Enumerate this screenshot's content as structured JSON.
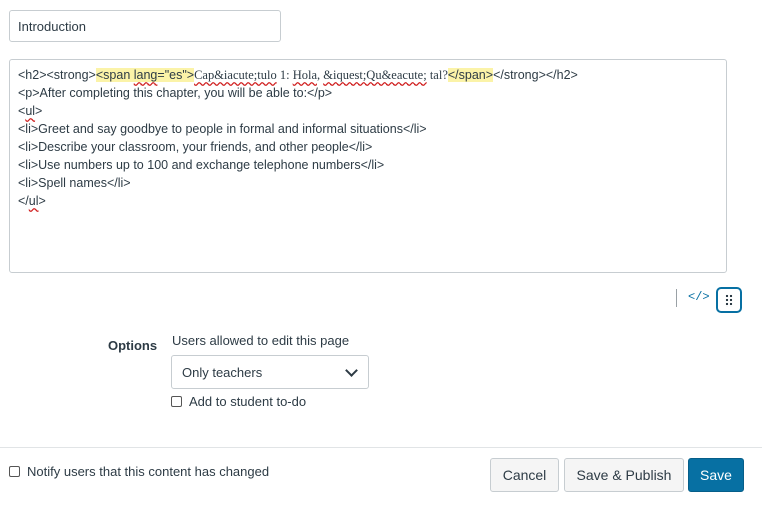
{
  "title_field": {
    "value": "Introduction"
  },
  "editor": {
    "line1": {
      "a": "<h2><strong>",
      "hl_open": {
        "a": "<span ",
        "b": "lang",
        "c": "=\"es\">"
      },
      "b1": "Cap&iacute;tulo",
      "b2": " 1: ",
      "b3": "Hola",
      "b4": ", ",
      "b5": "&iquest;Qu&eacute;",
      "b6": " tal?",
      "hl_close": "</span>",
      "c": "</strong></h2>"
    },
    "line2": "<p>After completing this chapter, you will be able to:</p>",
    "line3": {
      "a": "<",
      "b": "ul",
      "c": ">"
    },
    "line4": "<li>Greet and say goodbye to people in formal and informal situations</li>",
    "line5": "<li>Describe your classroom, your friends, and other people</li>",
    "line6": "<li>Use numbers up to 100 and exchange telephone numbers</li>",
    "line7": "<li>Spell names</li>",
    "line8": {
      "a": "</",
      "b": "ul",
      "c": ">"
    }
  },
  "toolbar": {
    "html_toggle": "</>",
    "resize_icon": "drag-handle-icon"
  },
  "options": {
    "label": "Options",
    "permission_label": "Users allowed to edit this page",
    "permission_selected": "Only teachers",
    "todo_label": "Add to student to-do"
  },
  "footer": {
    "notify_label": "Notify users that this content has changed",
    "cancel": "Cancel",
    "save_publish": "Save & Publish",
    "save": "Save"
  },
  "colors": {
    "accent": "#0770a3",
    "highlight": "#fbf3a8",
    "spellcheck": "#d02020"
  }
}
